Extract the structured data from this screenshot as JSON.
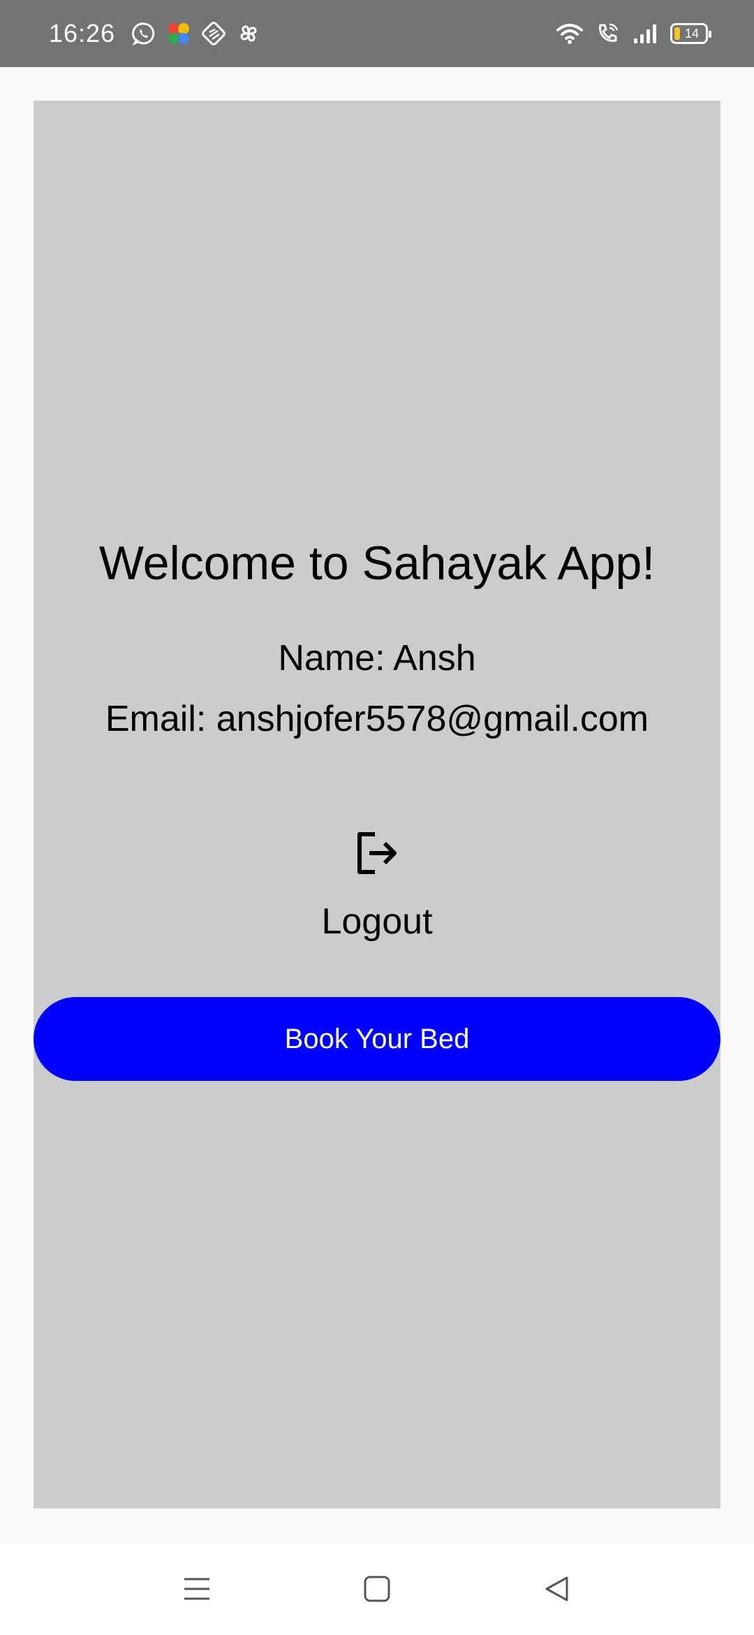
{
  "status_bar": {
    "time": "16:26",
    "battery_level": "14",
    "left_icons": [
      "whatsapp-icon",
      "app-colorful-icon",
      "app-badge-icon",
      "pinwheel-icon"
    ],
    "right_icons": [
      "wifi-icon",
      "wifi-call-icon",
      "signal-icon",
      "battery-icon"
    ]
  },
  "main": {
    "title": "Welcome to Sahayak App!",
    "name_line": "Name: Ansh",
    "email_line": "Email: anshjofer5578@gmail.com",
    "logout_label": "Logout",
    "book_button_label": "Book Your Bed"
  },
  "colors": {
    "status_bar": "#737373",
    "card_background": "#cccccc",
    "button_background": "#0000ff",
    "button_text": "#ffffff"
  },
  "nav_bar": {
    "buttons": [
      "menu-icon",
      "home-square-icon",
      "back-triangle-icon"
    ]
  }
}
